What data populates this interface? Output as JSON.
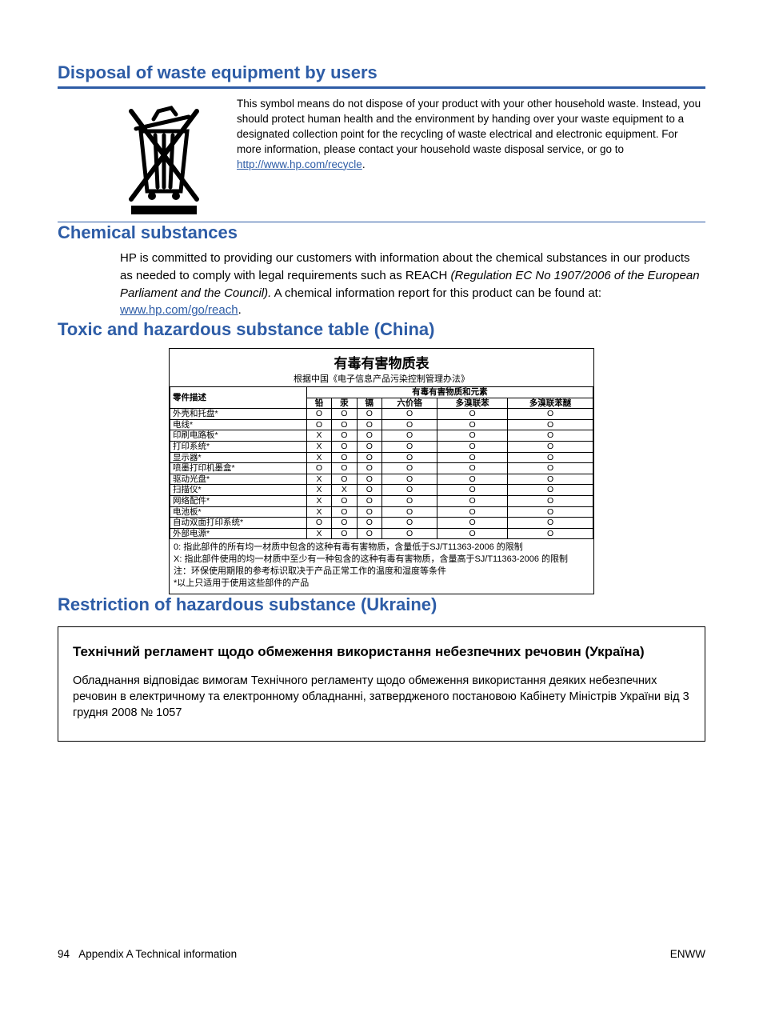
{
  "sections": {
    "waste": {
      "heading": "Disposal of waste equipment by users",
      "body_pre": "This symbol means do not dispose of your product with your other household waste. Instead, you should protect human health and the environment by handing over your waste equipment to a designated collection point for the recycling of waste electrical and electronic equipment. For more information, please contact your household waste disposal service, or go to ",
      "link_text": "http://www.hp.com/recycle",
      "body_post": "."
    },
    "chemical": {
      "heading": "Chemical substances",
      "body_pre": "HP is committed to providing our customers with information about the chemical substances in our products as needed to comply with legal requirements such as REACH ",
      "italic": "(Regulation EC No 1907/2006 of the European Parliament and the Council).",
      "body_mid": " A chemical information report for this product can be found at: ",
      "link_text": "www.hp.com/go/reach",
      "body_post": "."
    },
    "toxic": {
      "heading": "Toxic and hazardous substance table (China)",
      "table_title": "有毒有害物质表",
      "table_sub": "根据中国《电子信息产品污染控制管理办法》",
      "col_desc": "零件描述",
      "col_group": "有毒有害物质和元素",
      "cols": [
        "铅",
        "汞",
        "镉",
        "六价铬",
        "多溴联苯",
        "多溴联苯醚"
      ],
      "rows": [
        {
          "label": "外壳和托盘*",
          "v": [
            "O",
            "O",
            "O",
            "O",
            "O",
            "O"
          ]
        },
        {
          "label": "电线*",
          "v": [
            "O",
            "O",
            "O",
            "O",
            "O",
            "O"
          ]
        },
        {
          "label": "印刷电路板*",
          "v": [
            "X",
            "O",
            "O",
            "O",
            "O",
            "O"
          ]
        },
        {
          "label": "打印系统*",
          "v": [
            "X",
            "O",
            "O",
            "O",
            "O",
            "O"
          ]
        },
        {
          "label": "显示器*",
          "v": [
            "X",
            "O",
            "O",
            "O",
            "O",
            "O"
          ]
        },
        {
          "label": "喷墨打印机墨盒*",
          "v": [
            "O",
            "O",
            "O",
            "O",
            "O",
            "O"
          ]
        },
        {
          "label": "驱动光盘*",
          "v": [
            "X",
            "O",
            "O",
            "O",
            "O",
            "O"
          ]
        },
        {
          "label": "扫描仪*",
          "v": [
            "X",
            "X",
            "O",
            "O",
            "O",
            "O"
          ]
        },
        {
          "label": "网络配件*",
          "v": [
            "X",
            "O",
            "O",
            "O",
            "O",
            "O"
          ]
        },
        {
          "label": "电池板*",
          "v": [
            "X",
            "O",
            "O",
            "O",
            "O",
            "O"
          ]
        },
        {
          "label": "自动双面打印系统*",
          "v": [
            "O",
            "O",
            "O",
            "O",
            "O",
            "O"
          ]
        },
        {
          "label": "外部电源*",
          "v": [
            "X",
            "O",
            "O",
            "O",
            "O",
            "O"
          ]
        }
      ],
      "note1": "0: 指此部件的所有均一材质中包含的这种有毒有害物质，含量低于SJ/T11363-2006 的限制",
      "note2": "X: 指此部件使用的均一材质中至少有一种包含的这种有毒有害物质，含量高于SJ/T11363-2006 的限制",
      "note3": "注：环保使用期限的参考标识取决于产品正常工作的温度和湿度等条件",
      "note4": "*以上只适用于使用这些部件的产品"
    },
    "ukraine": {
      "heading": "Restriction of hazardous substance (Ukraine)",
      "box_title": "Технічний регламент щодо обмеження використання небезпечних речовин (Україна)",
      "box_body": "Обладнання відповідає вимогам Технічного регламенту щодо обмеження використання деяких небезпечних речовин в електричному та електронному обладнанні, затвердженого постановою Кабінету Міністрів України від 3 грудня 2008 № 1057"
    }
  },
  "footer": {
    "page_num": "94",
    "left_text": "Appendix A   Technical information",
    "right_text": "ENWW"
  }
}
